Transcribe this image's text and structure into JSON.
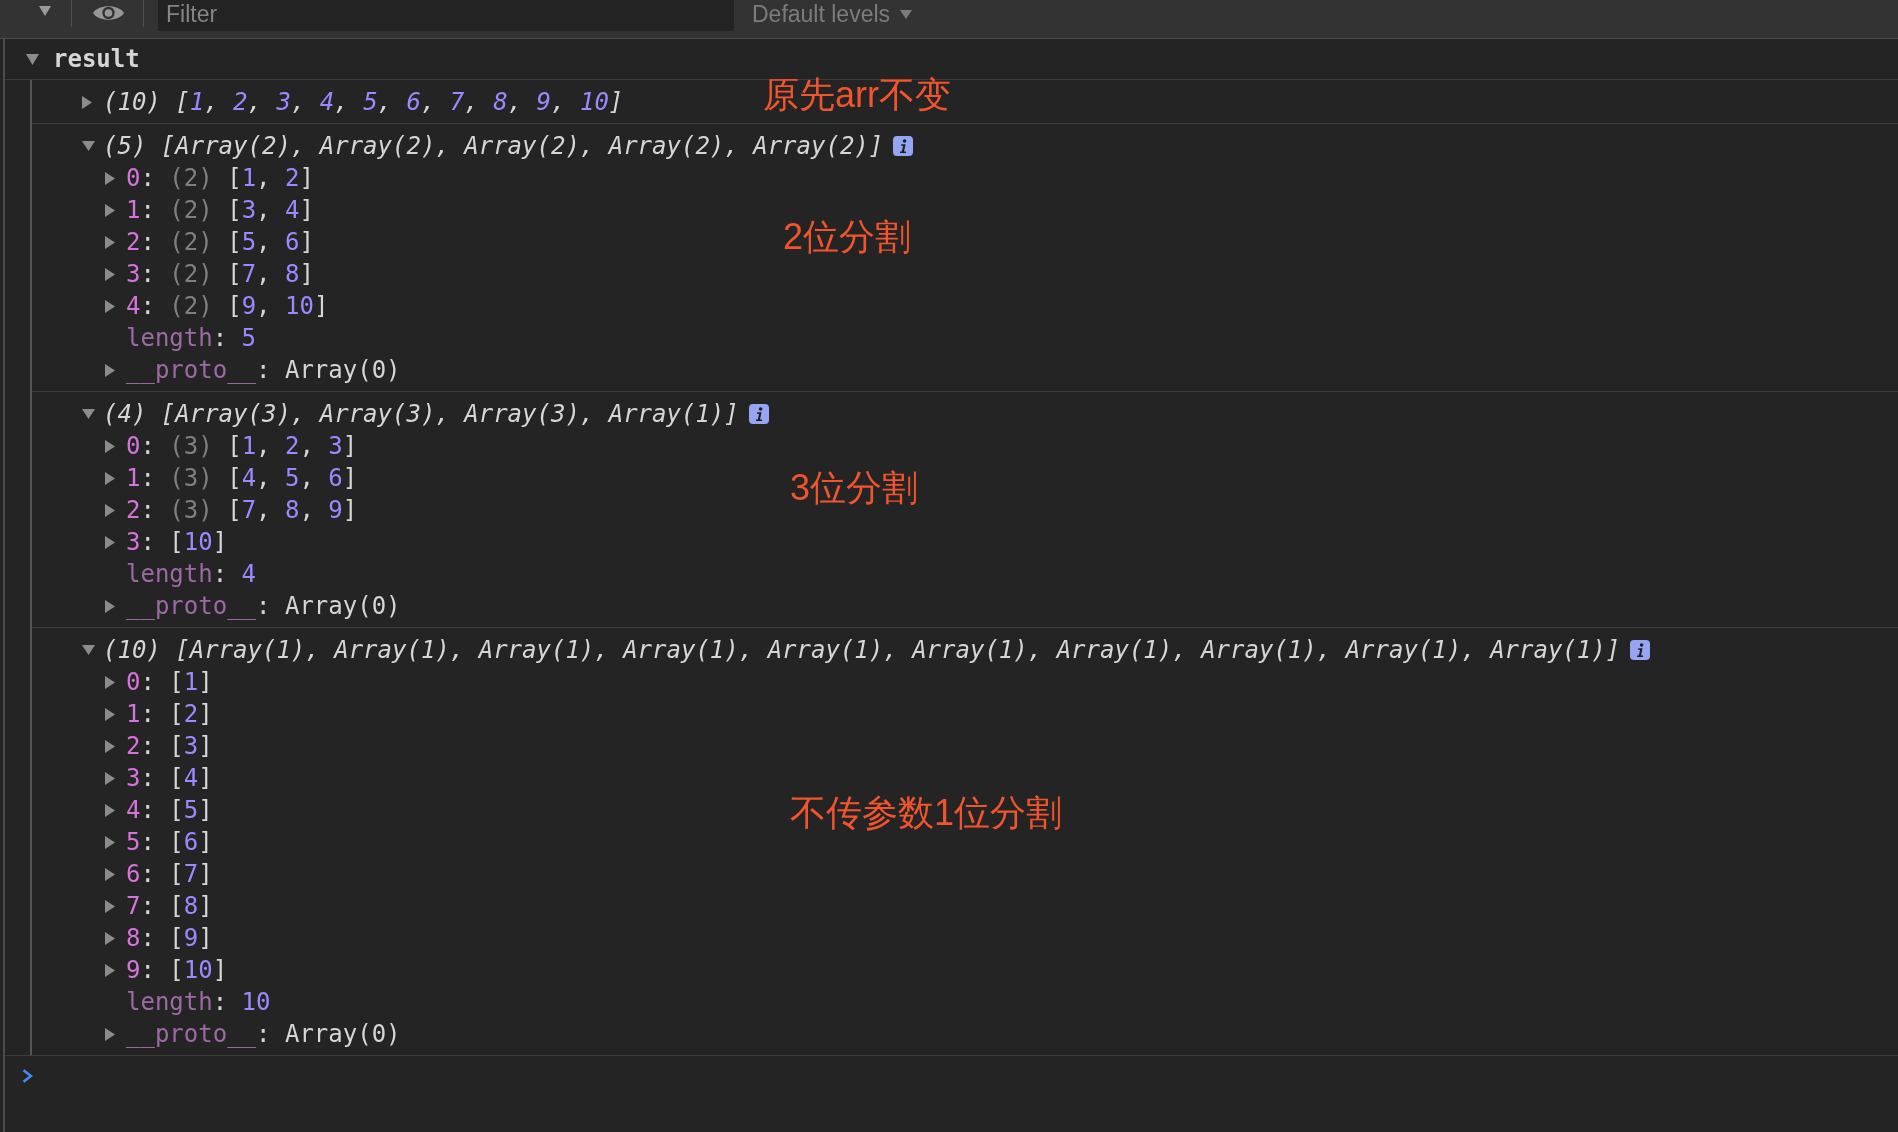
{
  "toolbar": {
    "filter": {
      "placeholder": "Filter"
    },
    "levels_dropdown": "Default levels"
  },
  "group": {
    "label": "result",
    "expanded": true,
    "messages": [
      {
        "expanded": false,
        "tokens": [
          {
            "kind": "text",
            "text": "(10) ["
          },
          {
            "kind": "number",
            "text": "1"
          },
          {
            "kind": "text",
            "text": ", "
          },
          {
            "kind": "number",
            "text": "2"
          },
          {
            "kind": "text",
            "text": ", "
          },
          {
            "kind": "number",
            "text": "3"
          },
          {
            "kind": "text",
            "text": ", "
          },
          {
            "kind": "number",
            "text": "4"
          },
          {
            "kind": "text",
            "text": ", "
          },
          {
            "kind": "number",
            "text": "5"
          },
          {
            "kind": "text",
            "text": ", "
          },
          {
            "kind": "number",
            "text": "6"
          },
          {
            "kind": "text",
            "text": ", "
          },
          {
            "kind": "number",
            "text": "7"
          },
          {
            "kind": "text",
            "text": ", "
          },
          {
            "kind": "number",
            "text": "8"
          },
          {
            "kind": "text",
            "text": ", "
          },
          {
            "kind": "number",
            "text": "9"
          },
          {
            "kind": "text",
            "text": ", "
          },
          {
            "kind": "number",
            "text": "10"
          },
          {
            "kind": "text",
            "text": "]"
          }
        ],
        "annotation": "原先arr不变"
      },
      {
        "expanded": true,
        "info_badge": true,
        "tokens": [
          {
            "kind": "text",
            "text": "(5) [Array(2), Array(2), Array(2), Array(2), Array(2)]"
          }
        ],
        "annotation": "2位分割",
        "children": [
          {
            "expanded": false,
            "tokens": [
              {
                "kind": "index",
                "text": "0"
              },
              {
                "kind": "text",
                "text": ": "
              },
              {
                "kind": "size",
                "text": "(2)"
              },
              {
                "kind": "text",
                "text": " ["
              },
              {
                "kind": "number",
                "text": "1"
              },
              {
                "kind": "text",
                "text": ", "
              },
              {
                "kind": "number",
                "text": "2"
              },
              {
                "kind": "text",
                "text": "]"
              }
            ]
          },
          {
            "expanded": false,
            "tokens": [
              {
                "kind": "index",
                "text": "1"
              },
              {
                "kind": "text",
                "text": ": "
              },
              {
                "kind": "size",
                "text": "(2)"
              },
              {
                "kind": "text",
                "text": " ["
              },
              {
                "kind": "number",
                "text": "3"
              },
              {
                "kind": "text",
                "text": ", "
              },
              {
                "kind": "number",
                "text": "4"
              },
              {
                "kind": "text",
                "text": "]"
              }
            ]
          },
          {
            "expanded": false,
            "tokens": [
              {
                "kind": "index",
                "text": "2"
              },
              {
                "kind": "text",
                "text": ": "
              },
              {
                "kind": "size",
                "text": "(2)"
              },
              {
                "kind": "text",
                "text": " ["
              },
              {
                "kind": "number",
                "text": "5"
              },
              {
                "kind": "text",
                "text": ", "
              },
              {
                "kind": "number",
                "text": "6"
              },
              {
                "kind": "text",
                "text": "]"
              }
            ]
          },
          {
            "expanded": false,
            "tokens": [
              {
                "kind": "index",
                "text": "3"
              },
              {
                "kind": "text",
                "text": ": "
              },
              {
                "kind": "size",
                "text": "(2)"
              },
              {
                "kind": "text",
                "text": " ["
              },
              {
                "kind": "number",
                "text": "7"
              },
              {
                "kind": "text",
                "text": ", "
              },
              {
                "kind": "number",
                "text": "8"
              },
              {
                "kind": "text",
                "text": "]"
              }
            ]
          },
          {
            "expanded": false,
            "tokens": [
              {
                "kind": "index",
                "text": "4"
              },
              {
                "kind": "text",
                "text": ": "
              },
              {
                "kind": "size",
                "text": "(2)"
              },
              {
                "kind": "text",
                "text": " ["
              },
              {
                "kind": "number",
                "text": "9"
              },
              {
                "kind": "text",
                "text": ", "
              },
              {
                "kind": "number",
                "text": "10"
              },
              {
                "kind": "text",
                "text": "]"
              }
            ]
          },
          {
            "tokens": [
              {
                "kind": "property",
                "text": "length"
              },
              {
                "kind": "text",
                "text": ": "
              },
              {
                "kind": "number",
                "text": "5"
              }
            ]
          },
          {
            "expanded": false,
            "tokens": [
              {
                "kind": "property",
                "text": "__proto__"
              },
              {
                "kind": "text",
                "text": ": Array(0)"
              }
            ]
          }
        ]
      },
      {
        "expanded": true,
        "info_badge": true,
        "tokens": [
          {
            "kind": "text",
            "text": "(4) [Array(3), Array(3), Array(3), Array(1)]"
          }
        ],
        "annotation": "3位分割",
        "children": [
          {
            "expanded": false,
            "tokens": [
              {
                "kind": "index",
                "text": "0"
              },
              {
                "kind": "text",
                "text": ": "
              },
              {
                "kind": "size",
                "text": "(3)"
              },
              {
                "kind": "text",
                "text": " ["
              },
              {
                "kind": "number",
                "text": "1"
              },
              {
                "kind": "text",
                "text": ", "
              },
              {
                "kind": "number",
                "text": "2"
              },
              {
                "kind": "text",
                "text": ", "
              },
              {
                "kind": "number",
                "text": "3"
              },
              {
                "kind": "text",
                "text": "]"
              }
            ]
          },
          {
            "expanded": false,
            "tokens": [
              {
                "kind": "index",
                "text": "1"
              },
              {
                "kind": "text",
                "text": ": "
              },
              {
                "kind": "size",
                "text": "(3)"
              },
              {
                "kind": "text",
                "text": " ["
              },
              {
                "kind": "number",
                "text": "4"
              },
              {
                "kind": "text",
                "text": ", "
              },
              {
                "kind": "number",
                "text": "5"
              },
              {
                "kind": "text",
                "text": ", "
              },
              {
                "kind": "number",
                "text": "6"
              },
              {
                "kind": "text",
                "text": "]"
              }
            ]
          },
          {
            "expanded": false,
            "tokens": [
              {
                "kind": "index",
                "text": "2"
              },
              {
                "kind": "text",
                "text": ": "
              },
              {
                "kind": "size",
                "text": "(3)"
              },
              {
                "kind": "text",
                "text": " ["
              },
              {
                "kind": "number",
                "text": "7"
              },
              {
                "kind": "text",
                "text": ", "
              },
              {
                "kind": "number",
                "text": "8"
              },
              {
                "kind": "text",
                "text": ", "
              },
              {
                "kind": "number",
                "text": "9"
              },
              {
                "kind": "text",
                "text": "]"
              }
            ]
          },
          {
            "expanded": false,
            "tokens": [
              {
                "kind": "index",
                "text": "3"
              },
              {
                "kind": "text",
                "text": ": ["
              },
              {
                "kind": "number",
                "text": "10"
              },
              {
                "kind": "text",
                "text": "]"
              }
            ]
          },
          {
            "tokens": [
              {
                "kind": "property",
                "text": "length"
              },
              {
                "kind": "text",
                "text": ": "
              },
              {
                "kind": "number",
                "text": "4"
              }
            ]
          },
          {
            "expanded": false,
            "tokens": [
              {
                "kind": "property",
                "text": "__proto__"
              },
              {
                "kind": "text",
                "text": ": Array(0)"
              }
            ]
          }
        ]
      },
      {
        "expanded": true,
        "info_badge": true,
        "tokens": [
          {
            "kind": "text",
            "text": "(10) [Array(1), Array(1), Array(1), Array(1), Array(1), Array(1), Array(1), Array(1), Array(1), Array(1)]"
          }
        ],
        "annotation": "不传参数1位分割",
        "children": [
          {
            "expanded": false,
            "tokens": [
              {
                "kind": "index",
                "text": "0"
              },
              {
                "kind": "text",
                "text": ": ["
              },
              {
                "kind": "number",
                "text": "1"
              },
              {
                "kind": "text",
                "text": "]"
              }
            ]
          },
          {
            "expanded": false,
            "tokens": [
              {
                "kind": "index",
                "text": "1"
              },
              {
                "kind": "text",
                "text": ": ["
              },
              {
                "kind": "number",
                "text": "2"
              },
              {
                "kind": "text",
                "text": "]"
              }
            ]
          },
          {
            "expanded": false,
            "tokens": [
              {
                "kind": "index",
                "text": "2"
              },
              {
                "kind": "text",
                "text": ": ["
              },
              {
                "kind": "number",
                "text": "3"
              },
              {
                "kind": "text",
                "text": "]"
              }
            ]
          },
          {
            "expanded": false,
            "tokens": [
              {
                "kind": "index",
                "text": "3"
              },
              {
                "kind": "text",
                "text": ": ["
              },
              {
                "kind": "number",
                "text": "4"
              },
              {
                "kind": "text",
                "text": "]"
              }
            ]
          },
          {
            "expanded": false,
            "tokens": [
              {
                "kind": "index",
                "text": "4"
              },
              {
                "kind": "text",
                "text": ": ["
              },
              {
                "kind": "number",
                "text": "5"
              },
              {
                "kind": "text",
                "text": "]"
              }
            ]
          },
          {
            "expanded": false,
            "tokens": [
              {
                "kind": "index",
                "text": "5"
              },
              {
                "kind": "text",
                "text": ": ["
              },
              {
                "kind": "number",
                "text": "6"
              },
              {
                "kind": "text",
                "text": "]"
              }
            ]
          },
          {
            "expanded": false,
            "tokens": [
              {
                "kind": "index",
                "text": "6"
              },
              {
                "kind": "text",
                "text": ": ["
              },
              {
                "kind": "number",
                "text": "7"
              },
              {
                "kind": "text",
                "text": "]"
              }
            ]
          },
          {
            "expanded": false,
            "tokens": [
              {
                "kind": "index",
                "text": "7"
              },
              {
                "kind": "text",
                "text": ": ["
              },
              {
                "kind": "number",
                "text": "8"
              },
              {
                "kind": "text",
                "text": "]"
              }
            ]
          },
          {
            "expanded": false,
            "tokens": [
              {
                "kind": "index",
                "text": "8"
              },
              {
                "kind": "text",
                "text": ": ["
              },
              {
                "kind": "number",
                "text": "9"
              },
              {
                "kind": "text",
                "text": "]"
              }
            ]
          },
          {
            "expanded": false,
            "tokens": [
              {
                "kind": "index",
                "text": "9"
              },
              {
                "kind": "text",
                "text": ": ["
              },
              {
                "kind": "number",
                "text": "10"
              },
              {
                "kind": "text",
                "text": "]"
              }
            ]
          },
          {
            "tokens": [
              {
                "kind": "property",
                "text": "length"
              },
              {
                "kind": "text",
                "text": ": "
              },
              {
                "kind": "number",
                "text": "10"
              }
            ]
          },
          {
            "expanded": false,
            "tokens": [
              {
                "kind": "property",
                "text": "__proto__"
              },
              {
                "kind": "text",
                "text": ": Array(0)"
              }
            ]
          }
        ]
      }
    ]
  }
}
